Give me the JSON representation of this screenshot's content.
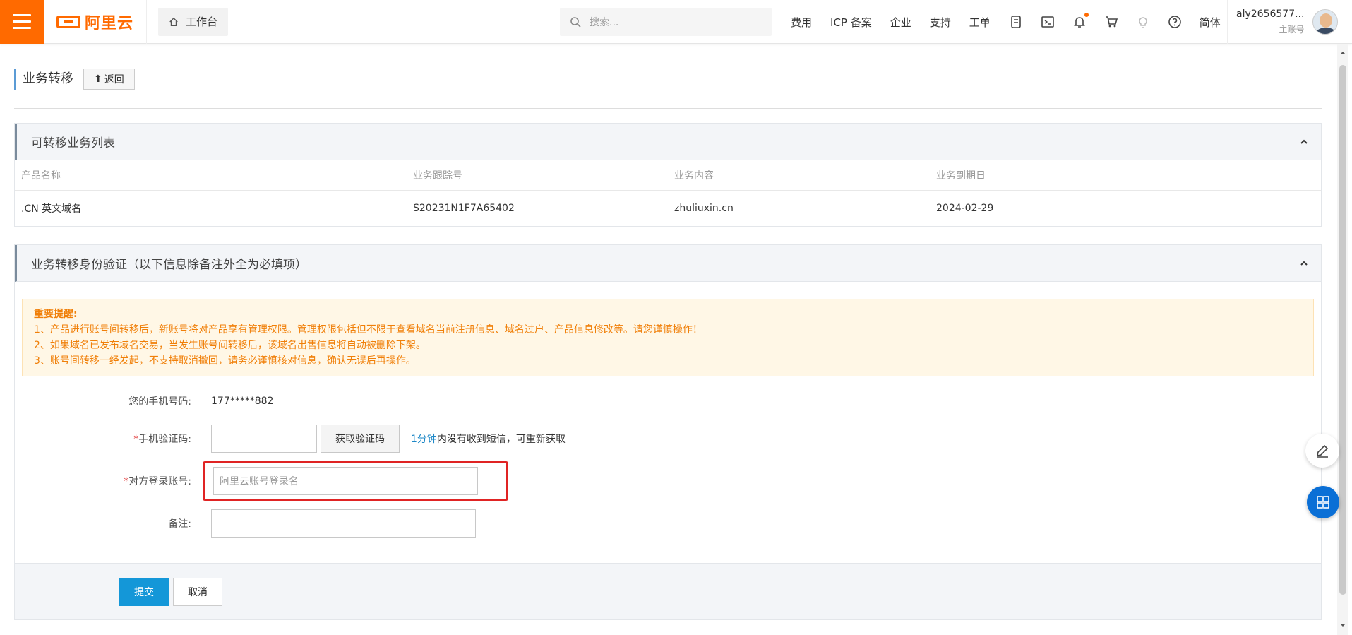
{
  "topbar": {
    "logo_text": "阿里云",
    "workbench": "工作台",
    "search_placeholder": "搜索...",
    "nav": [
      "费用",
      "ICP 备案",
      "企业",
      "支持",
      "工单"
    ],
    "lang": "简体",
    "user_name": "aly2656577...",
    "user_role": "主账号",
    "icons": [
      "api-icon",
      "terminal-icon",
      "bell-icon",
      "cart-icon",
      "lightbulb-icon",
      "help-icon"
    ]
  },
  "page": {
    "title": "业务转移",
    "back_label": "返回"
  },
  "transfer_list": {
    "title": "可转移业务列表",
    "columns": [
      "产品名称",
      "业务跟踪号",
      "业务内容",
      "业务到期日"
    ],
    "rows": [
      [
        ".CN 英文域名",
        "S20231N1F7A65402",
        "zhuliuxin.cn",
        "2024-02-29"
      ]
    ]
  },
  "verify": {
    "title": "业务转移身份验证（以下信息除备注外全为必填项）",
    "notice_title": "重要提醒:",
    "notices": [
      "1、产品进行账号间转移后，新账号将对产品享有管理权限。管理权限包括但不限于查看域名当前注册信息、域名过户、产品信息修改等。请您谨慎操作！",
      "2、如果域名已发布域名交易，当发生账号间转移后，该域名出售信息将自动被删除下架。",
      "3、账号间转移一经发起，不支持取消撤回，请务必谨慎核对信息，确认无误后再操作。"
    ],
    "phone_label": "您的手机号码:",
    "phone_value": "177*****882",
    "code_label": "手机验证码:",
    "code_value": "",
    "get_code": "获取验证码",
    "resend_highlight": "1分钟",
    "resend_text": "内没有收到短信，可重新获取",
    "account_label": "对方登录账号:",
    "account_placeholder": "阿里云账号登录名",
    "remark_label": "备注:",
    "remark_value": "",
    "required_mark": "*"
  },
  "actions": {
    "submit": "提交",
    "cancel": "取消"
  },
  "colors": {
    "brand": "#ff6a00",
    "primary": "#1497d8",
    "highlight_border": "#e02424",
    "notice_text": "#f07f08"
  }
}
